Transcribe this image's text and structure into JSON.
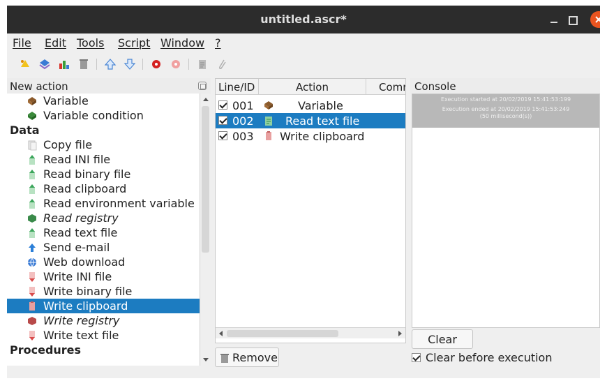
{
  "window": {
    "title": "untitled.ascr*"
  },
  "menu": [
    {
      "label": "File"
    },
    {
      "label": "Edit"
    },
    {
      "label": "Tools"
    },
    {
      "label": "Script"
    },
    {
      "label": "Window"
    },
    {
      "label": "?"
    }
  ],
  "left_panel": {
    "title": "New action",
    "items": [
      {
        "label": "Variable",
        "icon": "variable-icon",
        "kind": "item"
      },
      {
        "label": "Variable condition",
        "icon": "variable-condition-icon",
        "kind": "item"
      },
      {
        "label": "Data",
        "kind": "category"
      },
      {
        "label": "Copy file",
        "icon": "copy-file-icon",
        "kind": "item"
      },
      {
        "label": "Read INI file",
        "icon": "read-ini-icon",
        "kind": "item"
      },
      {
        "label": "Read binary file",
        "icon": "read-binary-icon",
        "kind": "item"
      },
      {
        "label": "Read clipboard",
        "icon": "read-clipboard-icon",
        "kind": "item"
      },
      {
        "label": "Read environment variable",
        "icon": "read-env-icon",
        "kind": "item"
      },
      {
        "label": "Read registry",
        "icon": "read-registry-icon",
        "kind": "item-italic"
      },
      {
        "label": "Read text file",
        "icon": "read-text-icon",
        "kind": "item"
      },
      {
        "label": "Send e-mail",
        "icon": "send-mail-icon",
        "kind": "item"
      },
      {
        "label": "Web download",
        "icon": "web-download-icon",
        "kind": "item"
      },
      {
        "label": "Write INI file",
        "icon": "write-ini-icon",
        "kind": "item"
      },
      {
        "label": "Write binary file",
        "icon": "write-binary-icon",
        "kind": "item"
      },
      {
        "label": "Write clipboard",
        "icon": "write-clipboard-icon",
        "kind": "item-selected"
      },
      {
        "label": "Write registry",
        "icon": "write-registry-icon",
        "kind": "item-italic"
      },
      {
        "label": "Write text file",
        "icon": "write-text-icon",
        "kind": "item"
      },
      {
        "label": "Procedures",
        "kind": "category"
      }
    ]
  },
  "script_table": {
    "columns": [
      "Line/ID",
      "Action",
      "Comr"
    ],
    "rows": [
      {
        "id": "001",
        "action": "Variable",
        "checked": true,
        "selected": false,
        "icon": "variable-icon"
      },
      {
        "id": "002",
        "action": "Read text file",
        "checked": true,
        "selected": true,
        "icon": "read-text-icon"
      },
      {
        "id": "003",
        "action": "Write clipboard",
        "checked": true,
        "selected": false,
        "icon": "write-clipboard-icon"
      }
    ],
    "remove_label": "Remove"
  },
  "console": {
    "title": "Console",
    "line1": "Execution started at 20/02/2019 15:41:53:199",
    "line2": "Execution ended at 20/02/2019 15:41:53:249",
    "line3": "(50 millisecond(s))",
    "clear_label": "Clear",
    "clear_before_label": "Clear before execution",
    "clear_before_checked": true
  },
  "colors": {
    "selection": "#1c7cc1",
    "titlebar": "#2c2c2c",
    "close": "#e95420"
  }
}
